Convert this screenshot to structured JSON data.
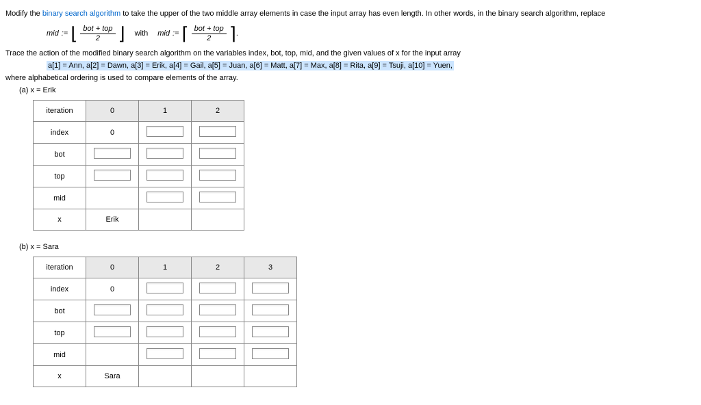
{
  "intro": {
    "prefix": "Modify the ",
    "link": "binary search algorithm",
    "rest": " to take the upper of the two middle array elements in case the input array has even length. In other words, in the binary search algorithm, replace"
  },
  "formula": {
    "lhs_label": "mid",
    "assign": ":=",
    "numerator": "bot + top",
    "denominator": "2",
    "with": "with",
    "rhs_label": "mid",
    "period": "."
  },
  "trace_text": {
    "line1": "Trace the action of the modified binary search algorithm on the variables index, bot, top, mid, and the given values of x for the input array",
    "array_def": "a[1] = Ann, a[2] = Dawn, a[3] = Erik, a[4] = Gail, a[5] = Juan, a[6] = Matt, a[7] = Max, a[8] = Rita, a[9] = Tsuji, a[10] = Yuen,",
    "line2": "where alphabetical ordering is used to compare elements of the array."
  },
  "part_a": {
    "label": "(a)   x = Erik",
    "headers": [
      "iteration",
      "0",
      "1",
      "2"
    ],
    "rows": [
      {
        "label": "index",
        "cells": [
          "0",
          "input",
          "input"
        ]
      },
      {
        "label": "bot",
        "cells": [
          "input",
          "input",
          "input"
        ]
      },
      {
        "label": "top",
        "cells": [
          "input",
          "input",
          "input"
        ]
      },
      {
        "label": "mid",
        "cells": [
          "",
          "input",
          "input"
        ]
      },
      {
        "label": "x",
        "cells": [
          "Erik",
          "",
          ""
        ]
      }
    ]
  },
  "part_b": {
    "label": "(b)   x = Sara",
    "headers": [
      "iteration",
      "0",
      "1",
      "2",
      "3"
    ],
    "rows": [
      {
        "label": "index",
        "cells": [
          "0",
          "input",
          "input",
          "input"
        ]
      },
      {
        "label": "bot",
        "cells": [
          "input",
          "input",
          "input",
          "input"
        ]
      },
      {
        "label": "top",
        "cells": [
          "input",
          "input",
          "input",
          "input"
        ]
      },
      {
        "label": "mid",
        "cells": [
          "",
          "input",
          "input",
          "input"
        ]
      },
      {
        "label": "x",
        "cells": [
          "Sara",
          "",
          "",
          ""
        ]
      }
    ]
  }
}
